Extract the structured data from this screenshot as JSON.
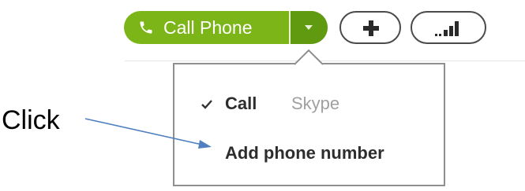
{
  "toolbar": {
    "call_button_label": "Call Phone",
    "call_icon": "phone-icon",
    "dropdown_icon": "chevron-down-icon",
    "add_icon": "plus-icon",
    "signal_icon": "signal-bars-icon",
    "colors": {
      "call_green": "#7cb518",
      "call_green_dark": "#5f9a10",
      "outline": "#4a4a4a"
    }
  },
  "menu": {
    "items": [
      {
        "label": "Call",
        "sublabel": "Skype",
        "checked": true
      },
      {
        "label": "Add phone number",
        "checked": false
      }
    ]
  },
  "annotation": {
    "text": "Click",
    "arrow_color": "#4f7fbf"
  }
}
